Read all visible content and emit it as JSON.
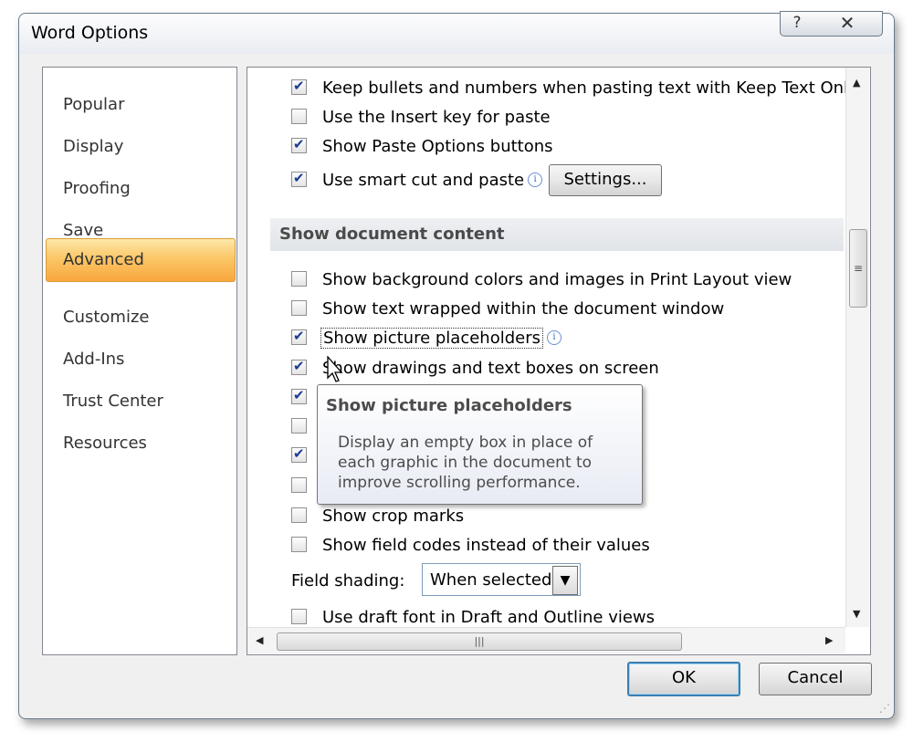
{
  "window": {
    "title": "Word Options",
    "help_label": "?",
    "close_label": "✕"
  },
  "nav": {
    "items": [
      "Popular",
      "Display",
      "Proofing",
      "Save",
      "Customize",
      "Add-Ins",
      "Trust Center",
      "Resources"
    ],
    "active": "Advanced"
  },
  "options_top": [
    {
      "label": "Keep bullets and numbers when pasting text with Keep Text Only",
      "checked": true
    },
    {
      "label": "Use the Insert key for paste",
      "checked": false
    },
    {
      "label": "Show Paste Options buttons",
      "checked": true
    },
    {
      "label": "Use smart cut and paste",
      "checked": true
    }
  ],
  "settings_button": "Settings...",
  "section_title": "Show document content",
  "options_content": [
    {
      "label": "Show background colors and images in Print Layout view",
      "checked": false
    },
    {
      "label": "Show text wrapped within the document window",
      "checked": false
    },
    {
      "label": "Show picture placeholders",
      "checked": true
    },
    {
      "label": "Show drawings and text boxes on screen",
      "checked": true
    }
  ],
  "hidden_checkboxes": [
    true,
    false,
    true,
    false
  ],
  "options_bottom": [
    {
      "label": "Show crop marks",
      "checked": false
    },
    {
      "label": "Show field codes instead of their values",
      "checked": false
    }
  ],
  "field_shading": {
    "label": "Field shading:",
    "value": "When selected"
  },
  "options_last": {
    "label": "Use draft font in Draft and Outline views",
    "checked": false
  },
  "tooltip": {
    "title": "Show picture placeholders",
    "body": "Display an empty box in place of each graphic in the document to improve scrolling performance."
  },
  "info_icon": "i",
  "buttons": {
    "ok": "OK",
    "cancel": "Cancel"
  }
}
